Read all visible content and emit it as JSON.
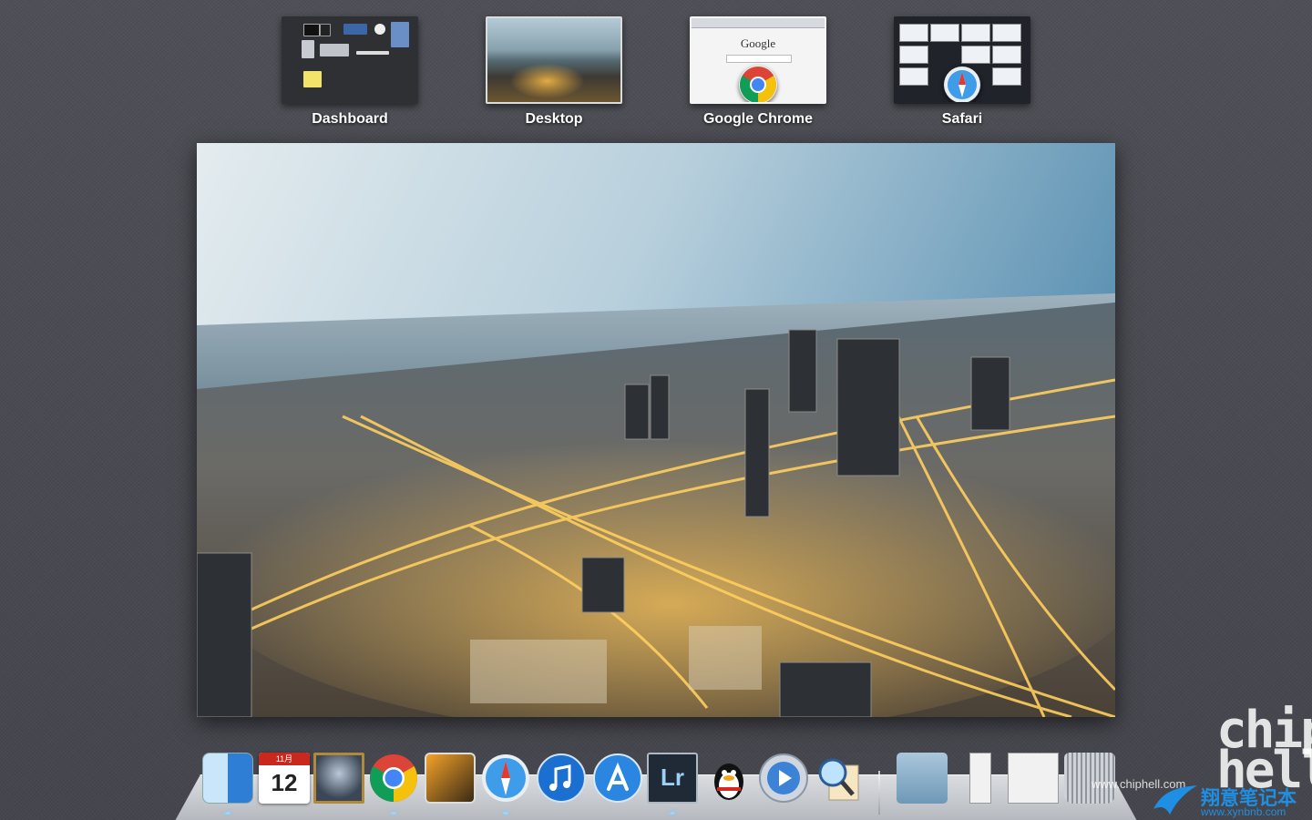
{
  "spaces": [
    {
      "label": "Dashboard",
      "active": false
    },
    {
      "label": "Desktop",
      "active": true
    },
    {
      "label": "Google Chrome",
      "active": false,
      "page_logo": "Google"
    },
    {
      "label": "Safari",
      "active": false
    }
  ],
  "dock": {
    "calendar": {
      "month": "11月",
      "day": "12"
    },
    "items": [
      "finder-icon",
      "calendar-icon",
      "warcraft-icon",
      "chrome-icon",
      "iphoto-icon",
      "safari-icon",
      "itunes-icon",
      "app-store-icon",
      "lightroom-icon",
      "qq-icon",
      "quicktime-icon",
      "preview-icon",
      "downloads-folder-icon",
      "qq-stack-icon",
      "document-stack-icon",
      "trash-icon"
    ],
    "lightroom_label": "Lr"
  },
  "watermarks": {
    "chiphell": "chip\nhell",
    "chiphell_url": "www.chiphell.com",
    "xynbnb": "翔意笔记本",
    "xynbnb_url": "www.xynbnb.com"
  },
  "colors": {
    "background": "#4a4b52",
    "accent_blue": "#1f8fe3",
    "chrome_red": "#db4437",
    "chrome_yellow": "#f4c20d",
    "chrome_green": "#0f9d58",
    "chrome_blue": "#4285f4"
  }
}
